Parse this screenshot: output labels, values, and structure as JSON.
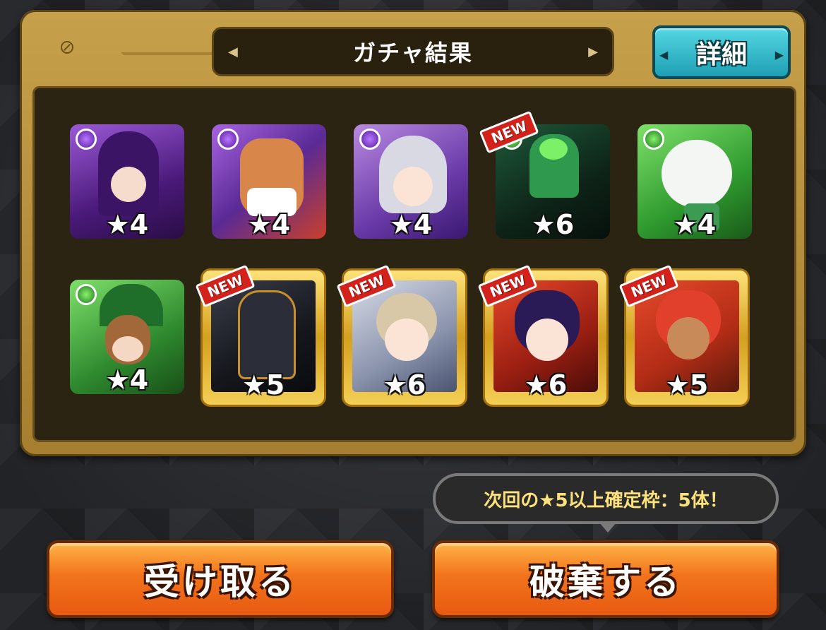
{
  "header": {
    "title": "ガチャ結果",
    "detail_label": "詳細"
  },
  "colors": {
    "accent": "#f2731c",
    "frame": "#c7a04b",
    "detail": "#1ea0b4"
  },
  "results": [
    {
      "stars": "★4",
      "attribute": "dark",
      "new": false
    },
    {
      "stars": "★4",
      "attribute": "dark",
      "new": false
    },
    {
      "stars": "★4",
      "attribute": "dark",
      "new": false
    },
    {
      "stars": "★6",
      "attribute": "wood",
      "new": true
    },
    {
      "stars": "★4",
      "attribute": "wood",
      "new": false
    },
    {
      "stars": "★4",
      "attribute": "wood",
      "new": false
    },
    {
      "stars": "★5",
      "attribute": "light",
      "new": true
    },
    {
      "stars": "★6",
      "attribute": "light",
      "new": true
    },
    {
      "stars": "★6",
      "attribute": "fire",
      "new": true
    },
    {
      "stars": "★5",
      "attribute": "fire",
      "new": true
    }
  ],
  "new_label": "NEW",
  "notice": "次回の★5以上確定枠：5体！",
  "buttons": {
    "receive": "受け取る",
    "discard": "破棄する"
  }
}
